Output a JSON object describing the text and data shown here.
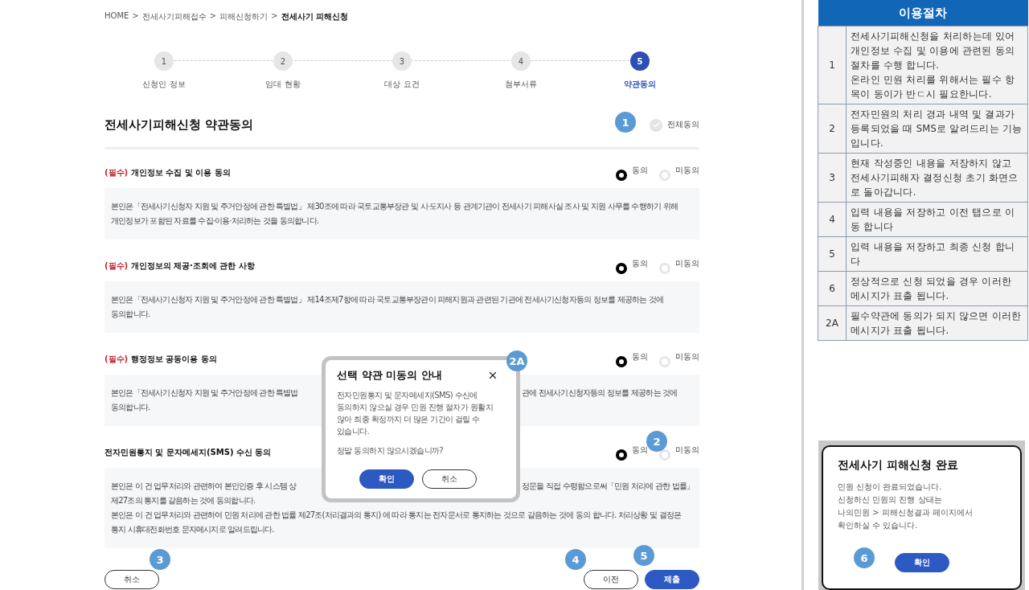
{
  "breadcrumb": [
    {
      "label": "HOME",
      "separator": ">",
      "current": false
    },
    {
      "label": "전세사기피해접수",
      "separator": ">",
      "current": false
    },
    {
      "label": "피해신청하기",
      "separator": ">",
      "current": false
    },
    {
      "label": "전세사기 피해신청",
      "current": true
    }
  ],
  "steps": [
    {
      "number": "1",
      "label": "신청인 정보",
      "selected": false
    },
    {
      "number": "2",
      "label": "임대 현황",
      "selected": false
    },
    {
      "number": "3",
      "label": "대상 요건",
      "selected": false
    },
    {
      "number": "4",
      "label": "첨부서류",
      "selected": false
    },
    {
      "number": "5",
      "label": "약관동의",
      "selected": true
    }
  ],
  "title": "전세사기피해신청 약관동의",
  "agree_all": {
    "label": "전체동의",
    "checked": false
  },
  "sections": [
    {
      "required_tag": "(필수)",
      "title": "개인정보 수집 및 이용 동의",
      "options": [
        {
          "label": "동의",
          "selected": true
        },
        {
          "label": "미동의",
          "selected": false
        }
      ],
      "lines": [
        {
          "text": "본인은「전세사기신청자 지원 및 주거안정에 관한 특별법」 제30조에 따라 국토교통부장관 및 시·도지사 등 관계기관이 전세사기 피해사실 조사 및 지원 사무를 수행하기 위해"
        },
        {
          "text": "개인정보가 포함된 자료를 수집·이용·처리하는 것을 동의합니다."
        }
      ]
    },
    {
      "required_tag": "(필수)",
      "title": "개인정보의 제공·조회에 관한 사항",
      "options": [
        {
          "label": "동의",
          "selected": true
        },
        {
          "label": "미동의",
          "selected": false
        }
      ],
      "lines": [
        {
          "text": "본인은「전세사기신청자 지원 및 주거안정에 관한 특별법」 제14조제7항에 따라 국토교통부장관이 피해지원과 관련된 기관에 전세사기신청자등의 정보를 제공하는 것에"
        },
        {
          "text": "동의합니다."
        }
      ]
    },
    {
      "required_tag": "(필수)",
      "title": "행정정보 공동이용 동의",
      "options": [
        {
          "label": "동의",
          "selected": true
        },
        {
          "label": "미동의",
          "selected": false
        }
      ],
      "lines": [
        {
          "left": "본인은「전세사기신청자 지원 및 주거안정에 관한 특별법",
          "right": "관에 전세사기신청자등의 정보를 제공하는 것에"
        },
        {
          "text": "동의합니다."
        }
      ]
    },
    {
      "title": "전자민원통지 및 문자메세지(SMS) 수신 동의",
      "options": [
        {
          "label": "동의",
          "selected": true
        },
        {
          "label": "미동의",
          "selected": false
        }
      ],
      "lines": [
        {
          "left": "본인은 이 건 업무처리와 관련하여 본인인증 후 시스템 상",
          "right": "정문을 직접 수령함으로써「민원 처리에 관한 법률」"
        },
        {
          "text": "제27조의 통지를 갈음하는 것에 동의합니다."
        },
        {
          "text": "본인은 이 건 업무처리와 관련하여 민원 처리에 관한 법률 제27조(처리결과의 통지) 에 따라 통지는 전자문서로 통지하는 것으로 갈음하는 것에 동의 합니다. 처리상황 및 결정은"
        },
        {
          "text": "통지 시휴대전화번호 문자메시지로 알려드립니다."
        }
      ]
    }
  ],
  "buttons": {
    "cancel": "취소",
    "prev": "이전",
    "submit": "제출"
  },
  "modal": {
    "title": "선택 약관 미동의 안내",
    "message_lines": [
      "전자민원통지 및 문자메세지(SMS) 수신에",
      "동의하지 않으실 경우 민원 진행 절차가 원활치",
      "않아 최종 확정까지 더 많은 기간이 걸릴 수",
      "있습니다."
    ],
    "question": "정말 동의하지 않으시겠습니까?",
    "confirm": "확인",
    "cancel": "취소"
  },
  "badges": [
    {
      "label": "1"
    },
    {
      "label": "2"
    },
    {
      "label": "2A"
    },
    {
      "label": "3"
    },
    {
      "label": "4"
    },
    {
      "label": "5"
    },
    {
      "label": "6"
    }
  ],
  "procedure": {
    "title": "이용절차",
    "rows": [
      {
        "key": "1",
        "text": "전세사기피해신청을 처리하는데 있어 개인정보 수집 및 이용에 관련된 동의 절차를 수행 합니다.\n온라인 민원 처리를 위해서는 필수 항목이 동이가 반ㄷ시 필요한니다."
      },
      {
        "key": "2",
        "text": "전자민원의 처리 경과 내역 및 결과가 등록되었을 때 SMS로 알려드리는 기능 입니다."
      },
      {
        "key": "3",
        "text": "현재 작성중인 내용을 저장하지 않고 전세사기피해자 결정신청 초기 화면으로 돌아갑니다."
      },
      {
        "key": "4",
        "text": "입력 내용을 저장하고 이전 탭으로 이동 합니다"
      },
      {
        "key": "5",
        "text": "입력 내용을 저장하고 최종 신청 합니다"
      },
      {
        "key": "6",
        "text": "정상적으로 신청 되었을 경우 이러한 메시지가 표출 됩니다."
      },
      {
        "key": "2A",
        "text": "필수약관에 동의가 되지 않으면 이러한 메시지가 표출 됩니다."
      }
    ]
  },
  "complete_modal": {
    "title": "전세사기 피해신청 완료",
    "lines": [
      "민원 신청이 완료되었습니다.",
      "신청하신 민원의 진행 상태는",
      "나의민원 > 피해신청결과 페이지에서",
      "확인하실 수 있습니다."
    ],
    "confirm": "확인"
  }
}
